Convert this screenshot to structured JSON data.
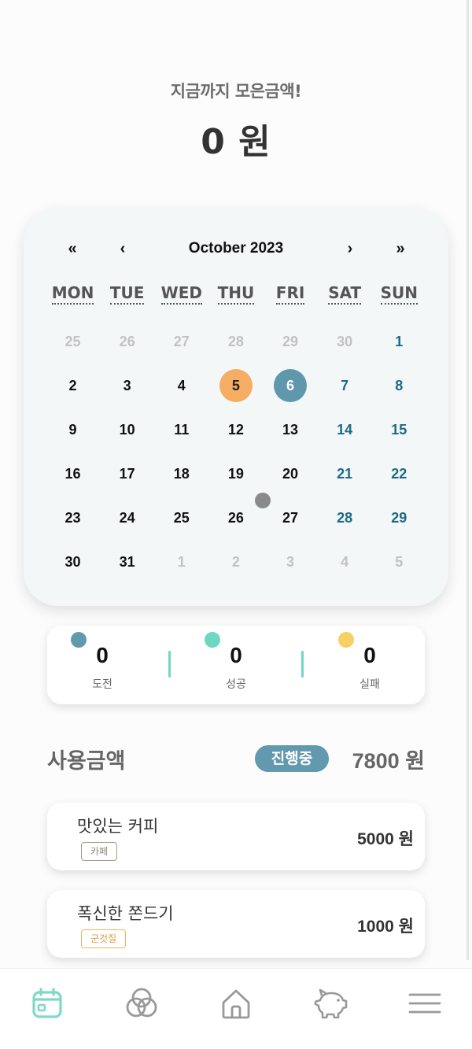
{
  "header": {
    "subtitle": "지금까지 모은금액!",
    "amount": "0 원"
  },
  "calendar": {
    "nav": {
      "prev_year": "«",
      "prev_month": "‹",
      "next_month": "›",
      "next_year": "»"
    },
    "title": "October 2023",
    "weekdays": [
      "MON",
      "TUE",
      "WED",
      "THU",
      "FRI",
      "SAT",
      "SUN"
    ],
    "weeks": [
      [
        "25",
        "26",
        "27",
        "28",
        "29",
        "30",
        "1"
      ],
      [
        "2",
        "3",
        "4",
        "5",
        "6",
        "7",
        "8"
      ],
      [
        "9",
        "10",
        "11",
        "12",
        "13",
        "14",
        "15"
      ],
      [
        "16",
        "17",
        "18",
        "19",
        "20",
        "21",
        "22"
      ],
      [
        "23",
        "24",
        "25",
        "26",
        "27",
        "28",
        "29"
      ],
      [
        "30",
        "31",
        "1",
        "2",
        "3",
        "4",
        "5"
      ]
    ],
    "colors": {
      "orange_highlight": "#f4ad62",
      "blue_highlight": "#5f97ad",
      "weekend": "#1d6a86",
      "other_month": "#c2c2c2"
    }
  },
  "stats": [
    {
      "value": "0",
      "label": "도전",
      "color": "#6299ae"
    },
    {
      "value": "0",
      "label": "성공",
      "color": "#6fd6c2"
    },
    {
      "value": "0",
      "label": "실패",
      "color": "#f7d065"
    }
  ],
  "spending": {
    "title": "사용금액",
    "status": "진행중",
    "total": "7800 원",
    "items": [
      {
        "name": "맛있는 커피",
        "tag": "카페",
        "tag_color": "#a39c8c",
        "amount": "5000 원"
      },
      {
        "name": "폭신한 쫀드기",
        "tag": "군것질",
        "tag_color": "#f0b262",
        "amount": "1000 원"
      }
    ]
  },
  "bottom_nav": [
    {
      "icon": "calendar-icon",
      "active": true,
      "color": "#7fd8c8"
    },
    {
      "icon": "venn-icon",
      "active": false,
      "color": "#999"
    },
    {
      "icon": "home-icon",
      "active": false,
      "color": "#999"
    },
    {
      "icon": "piggy-bank-icon",
      "active": false,
      "color": "#999"
    },
    {
      "icon": "menu-icon",
      "active": false,
      "color": "#999"
    }
  ]
}
